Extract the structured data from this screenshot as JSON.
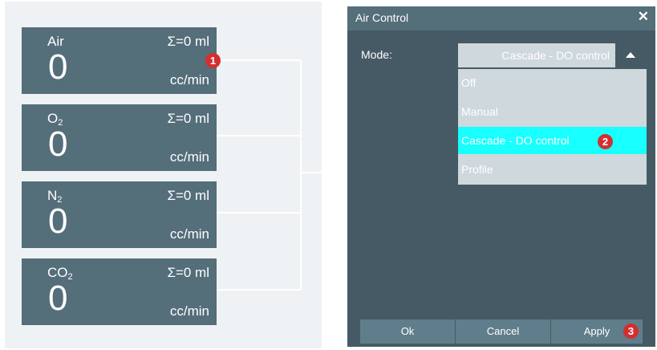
{
  "gas_cards": [
    {
      "name": "Air",
      "sub": "",
      "total": "Σ=0 ml",
      "value": "0",
      "unit": "cc/min"
    },
    {
      "name": "O",
      "sub": "2",
      "total": "Σ=0 ml",
      "value": "0",
      "unit": "cc/min"
    },
    {
      "name": "N",
      "sub": "2",
      "total": "Σ=0 ml",
      "value": "0",
      "unit": "cc/min"
    },
    {
      "name": "CO",
      "sub": "2",
      "total": "Σ=0 ml",
      "value": "0",
      "unit": "cc/min"
    }
  ],
  "markers": [
    "1",
    "2",
    "3"
  ],
  "dialog": {
    "title": "Air Control",
    "close": "✕",
    "mode_label": "Mode:",
    "selected_mode": "Cascade - DO control",
    "options": [
      "Off",
      "Manual",
      "Cascade - DO control",
      "Profile"
    ],
    "buttons": {
      "ok": "Ok",
      "cancel": "Cancel",
      "apply": "Apply"
    }
  },
  "colors": {
    "card": "#546e7a",
    "dialog_bg": "#455a64",
    "dropdown": "#cfd8dc",
    "highlight": "#18ffff",
    "marker": "#d32f2f"
  }
}
